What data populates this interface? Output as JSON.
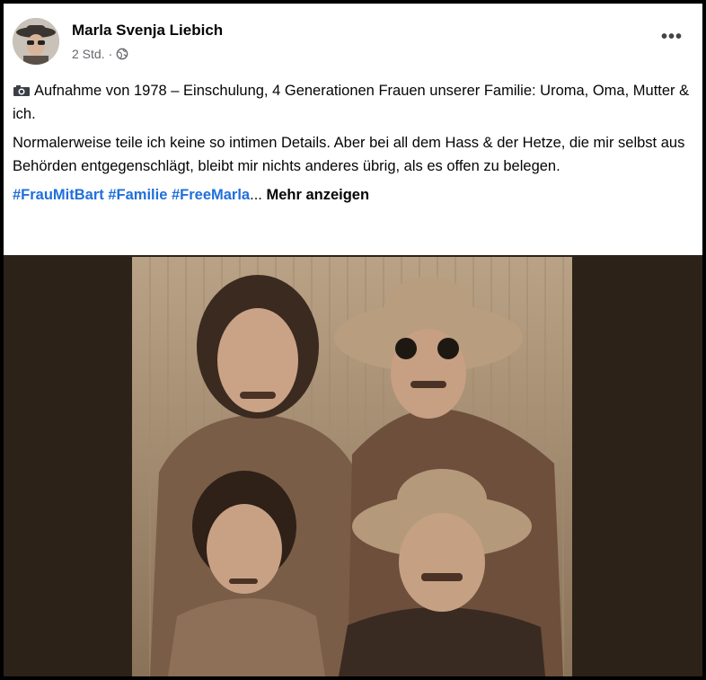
{
  "post": {
    "author": "Marla Svenja Liebich",
    "time": "2 Std.",
    "separator": "·",
    "privacy_icon": "globe-icon",
    "more_icon": "more-options-icon",
    "more_symbol": "•••",
    "line1_icon": "camera-icon",
    "para1": "Aufnahme von 1978 – Einschulung, 4 Generationen Frauen unserer Familie: Uroma, Oma, Mutter & ich.",
    "para2": "Normalerweise teile ich keine so intimen Details. Aber bei all dem Hass & der Hetze, die mir selbst aus Behörden entgegenschlägt, bleibt mir nichts anderes übrig, als es offen zu belegen.",
    "tags": [
      "#FrauMitBart",
      " #Familie",
      " #FreeMarla"
    ],
    "ellipsis": "...",
    "show_more": " Mehr anzeigen"
  },
  "colors": {
    "link": "#216fdb",
    "text": "#050505",
    "muted": "#65676b"
  }
}
